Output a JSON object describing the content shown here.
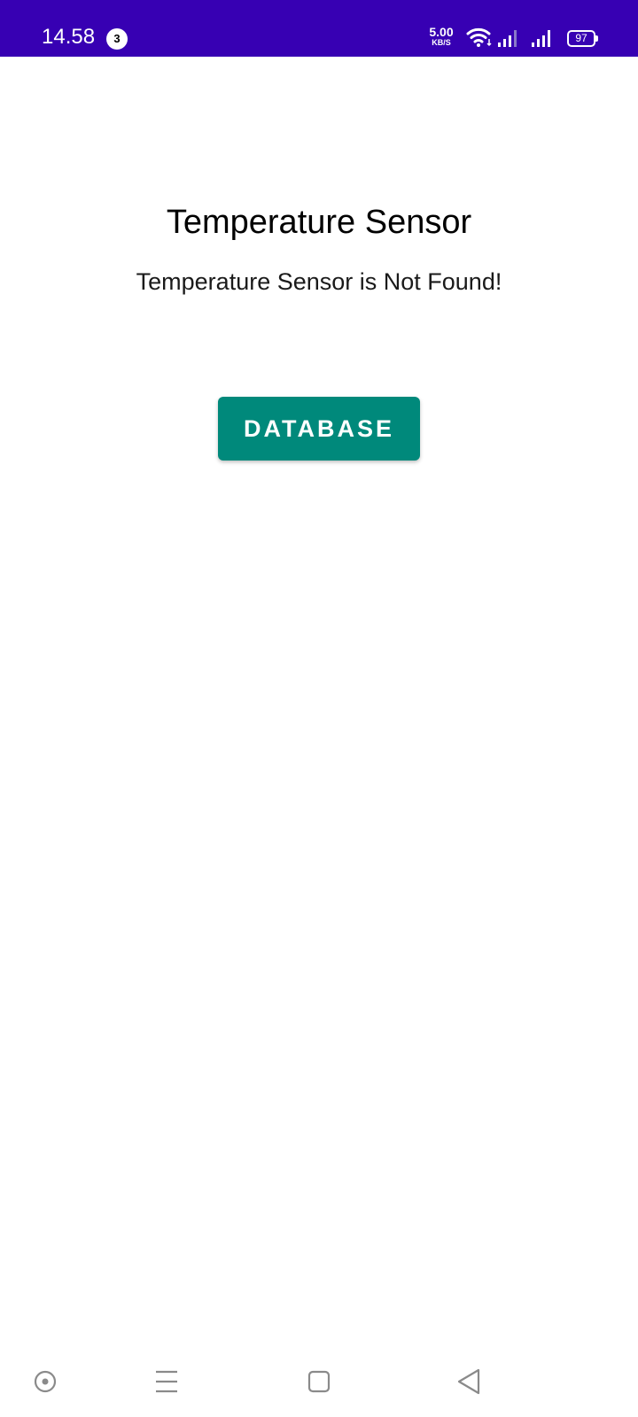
{
  "status_bar": {
    "time": "14.58",
    "notification_count": "3",
    "net_speed_value": "5.00",
    "net_speed_unit": "KB/S",
    "battery_level": "97",
    "background_color": "#3700b3"
  },
  "main": {
    "title": "Temperature Sensor",
    "message": "Temperature Sensor is Not Found!",
    "database_button_label": "DATABASE",
    "button_color": "#00897b"
  },
  "nav_bar": {
    "icons": [
      "assistant-dot-icon",
      "menu-lines-icon",
      "home-square-icon",
      "back-triangle-icon"
    ]
  }
}
